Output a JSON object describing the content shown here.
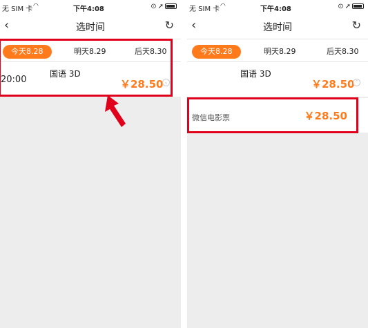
{
  "left": {
    "status": {
      "carrier": "无 SIM 卡",
      "time": "下午4:08"
    },
    "nav": {
      "title": "选时间"
    },
    "dates": [
      {
        "label": "今天8.28",
        "active": true
      },
      {
        "label": "明天8.29",
        "active": false
      },
      {
        "label": "后天8.30",
        "active": false
      }
    ],
    "show": {
      "language": "国语 3D",
      "time": "20:00",
      "price": "￥28.50"
    }
  },
  "right": {
    "status": {
      "carrier": "无 SIM 卡",
      "time": "下午4:08"
    },
    "nav": {
      "title": "选时间"
    },
    "dates": [
      {
        "label": "今天8.28",
        "active": true
      },
      {
        "label": "明天8.29",
        "active": false
      },
      {
        "label": "后天8.30",
        "active": false
      }
    ],
    "show": {
      "language": "国语 3D",
      "price": "￥28.50"
    },
    "channel": {
      "name": "微信电影票",
      "price": "￥28.50"
    }
  },
  "colors": {
    "accent": "#ff7a1a",
    "annotation": "#e0001b"
  },
  "icons": [
    "back-arrow-icon",
    "refresh-icon",
    "wifi-icon",
    "location-icon",
    "battery-icon",
    "expand-icon",
    "red-arrow-icon"
  ]
}
